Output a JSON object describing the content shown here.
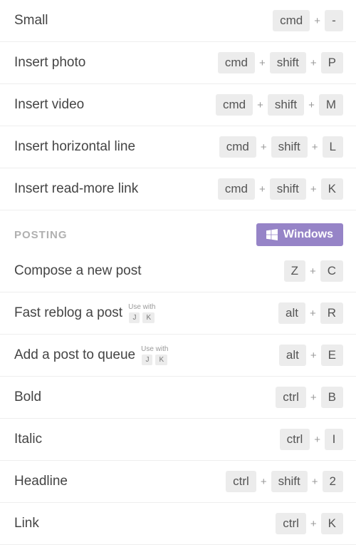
{
  "rows_top": [
    {
      "label": "Small",
      "keys": [
        "cmd",
        "-"
      ]
    },
    {
      "label": "Insert photo",
      "keys": [
        "cmd",
        "shift",
        "P"
      ]
    },
    {
      "label": "Insert video",
      "keys": [
        "cmd",
        "shift",
        "M"
      ]
    },
    {
      "label": "Insert horizontal line",
      "keys": [
        "cmd",
        "shift",
        "L"
      ]
    },
    {
      "label": "Insert read-more link",
      "keys": [
        "cmd",
        "shift",
        "K"
      ]
    }
  ],
  "section": {
    "title": "POSTING",
    "os_label": "Windows"
  },
  "rows_bottom": [
    {
      "label": "Compose a new post",
      "keys": [
        "Z",
        "C"
      ],
      "usewith": null
    },
    {
      "label": "Fast reblog a post",
      "keys": [
        "alt",
        "R"
      ],
      "usewith": {
        "label": "Use with",
        "keys": [
          "J",
          "K"
        ]
      }
    },
    {
      "label": "Add a post to queue",
      "keys": [
        "alt",
        "E"
      ],
      "usewith": {
        "label": "Use with",
        "keys": [
          "J",
          "K"
        ]
      }
    },
    {
      "label": "Bold",
      "keys": [
        "ctrl",
        "B"
      ],
      "usewith": null
    },
    {
      "label": "Italic",
      "keys": [
        "ctrl",
        "I"
      ],
      "usewith": null
    },
    {
      "label": "Headline",
      "keys": [
        "ctrl",
        "shift",
        "2"
      ],
      "usewith": null
    },
    {
      "label": "Link",
      "keys": [
        "ctrl",
        "K"
      ],
      "usewith": null
    }
  ]
}
